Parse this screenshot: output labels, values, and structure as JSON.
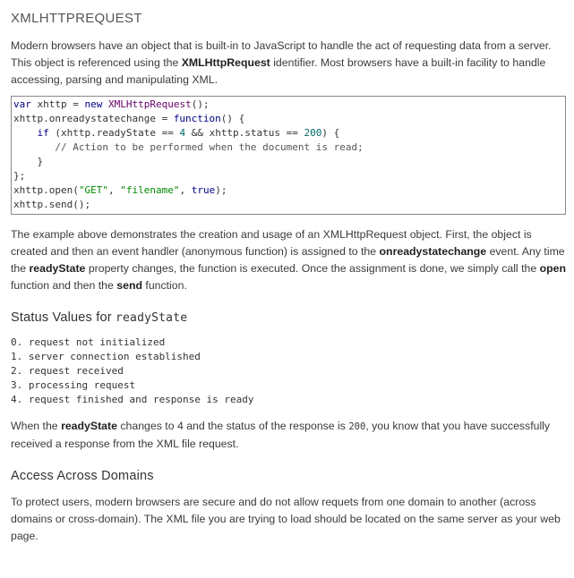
{
  "heading": "XMLHTTPREQUEST",
  "intro": {
    "part1": "Modern browsers have an object that is built-in to JavaScript to handle the act of requesting data from a server. This object is referenced using the ",
    "bold1": "XMLHttpRequest",
    "part2": " identifier. Most browsers have a built-in facility to handle accessing, parsing and manipulating XML."
  },
  "code": {
    "l1_a": "var",
    "l1_b": " xhttp = ",
    "l1_c": "new",
    "l1_d": " ",
    "l1_e": "XMLHttpRequest",
    "l1_f": "();",
    "l2_a": "xhttp.onreadystatechange = ",
    "l2_b": "function",
    "l2_c": "() {",
    "l3_a": "    ",
    "l3_b": "if",
    "l3_c": " (xhttp.readyState == ",
    "l3_d": "4",
    "l3_e": " && xhttp.status == ",
    "l3_f": "200",
    "l3_g": ") {",
    "l4": "       // Action to be performed when the document is read;",
    "l5": "    }",
    "l6": "};",
    "l7_a": "xhttp.open(",
    "l7_b": "\"GET\"",
    "l7_c": ", ",
    "l7_d": "\"filename\"",
    "l7_e": ", ",
    "l7_f": "true",
    "l7_g": ");",
    "l8": "xhttp.send();"
  },
  "explanation": {
    "p1": "The example above demonstrates the creation and usage of an XMLHttpRequest object. First, the object is created and then an event handler (anonymous function) is assigned to the ",
    "b1": "onreadystatechange",
    "p2": " event. Any time the ",
    "b2": "readyState",
    "p3": " property changes, the function is executed. Once the assignment is done, we simply call the ",
    "b3": "open",
    "p4": " function and then the ",
    "b4": "send",
    "p5": " function."
  },
  "status_section": {
    "title_text": "Status Values for ",
    "title_code": "readyState",
    "items": [
      "0. request not initialized",
      "1. server connection established",
      "2. request received",
      "3. processing request",
      "4. request finished and response is ready"
    ],
    "note": {
      "p1": "When the ",
      "b1": "readyState",
      "p2": " changes to 4 and the status of the response is ",
      "code1": "200",
      "p3": ", you know that you have successfully received a response from the XML file request."
    }
  },
  "domains_section": {
    "title": "Access Across Domains",
    "text": "To protect users, modern browsers are secure and do not allow requets from one domain to another (across domains or cross-domain). The XML file you are trying to load should be located on the same server as your web page."
  }
}
